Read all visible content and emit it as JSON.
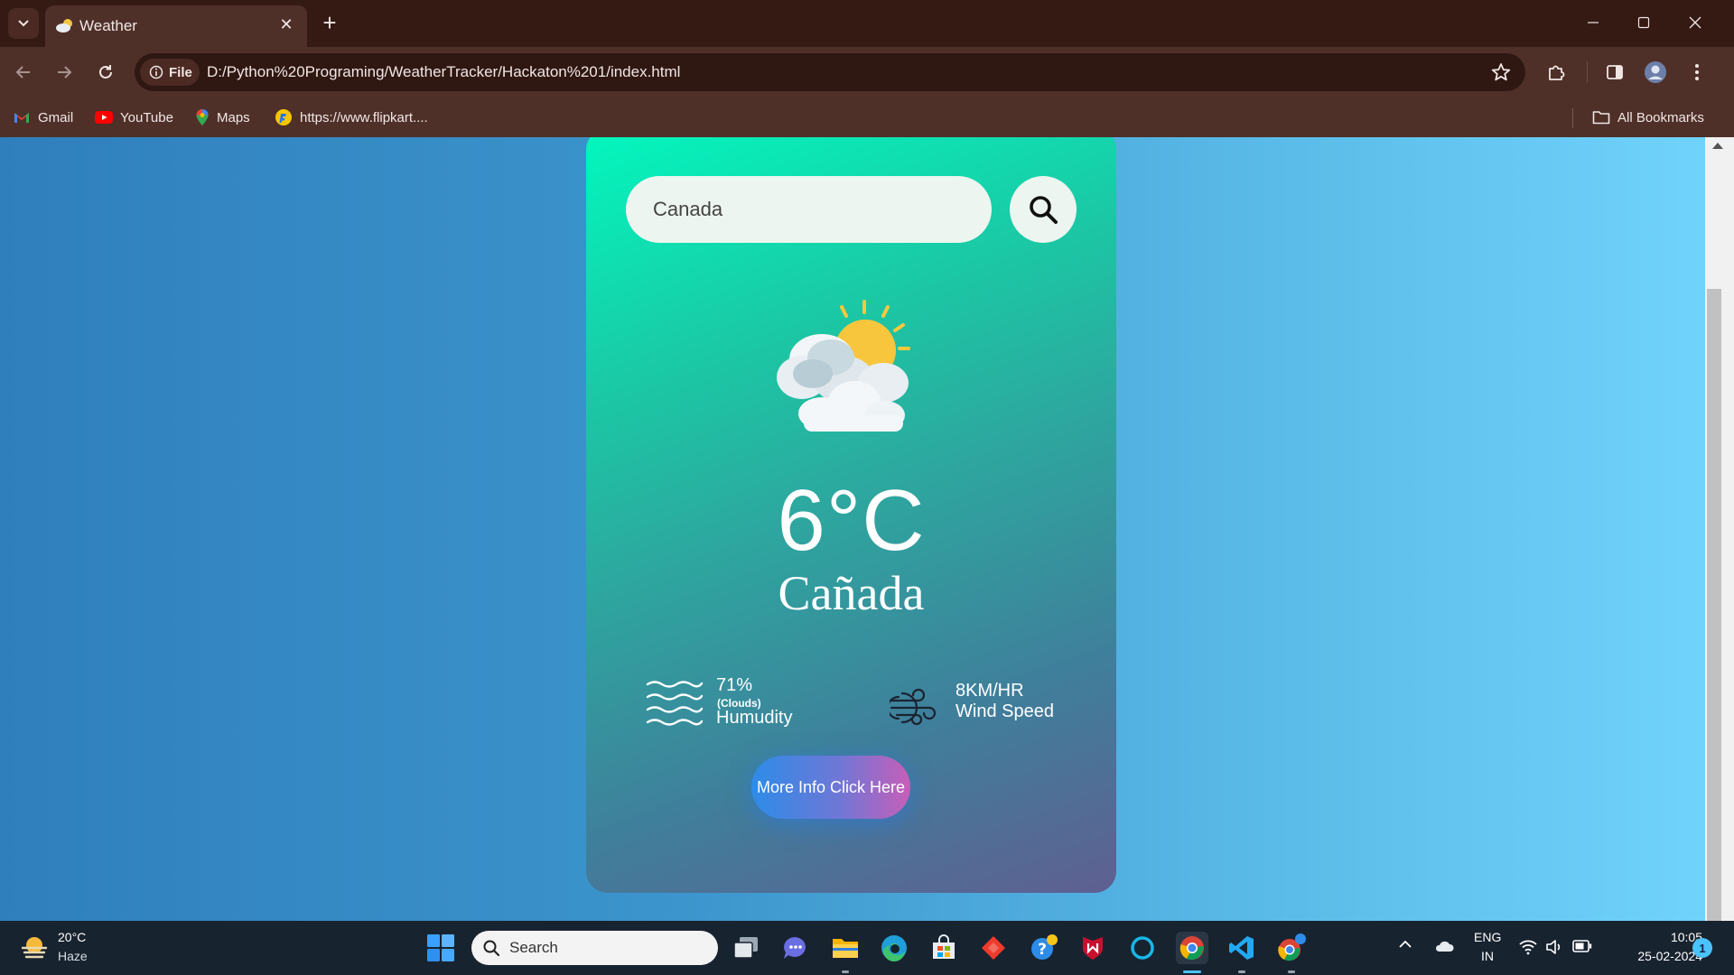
{
  "browser": {
    "tab_title": "Weather",
    "new_tab_symbol": "+",
    "close_symbol": "✕",
    "site_info_label": "File",
    "url": "D:/Python%20Programing/WeatherTracker/Hackaton%201/index.html",
    "bookmarks": [
      {
        "label": "Gmail",
        "icon": "gmail-icon"
      },
      {
        "label": "YouTube",
        "icon": "youtube-icon"
      },
      {
        "label": "Maps",
        "icon": "maps-icon"
      },
      {
        "label": "https://www.flipkart....",
        "icon": "flipkart-icon"
      }
    ],
    "all_bookmarks_label": "All Bookmarks"
  },
  "weather_app": {
    "search": {
      "value": "Canada"
    },
    "condition_icon": "sun-behind-clouds-icon",
    "temperature": "6°C",
    "city": "Cañada",
    "humidity": {
      "value": "71%",
      "note": "(Clouds)",
      "label": "Humudity"
    },
    "wind": {
      "value": "8KM/HR",
      "label": "Wind Speed"
    },
    "more_info_label": "More Info Click Here",
    "colors": {
      "card_gradient_start": "#03f7be",
      "card_gradient_end": "#5f5f91",
      "page_bg_left": "#2f7fbd",
      "page_bg_right": "#70d3fb",
      "button_gradient_start": "#2d8ce8",
      "button_gradient_end": "#c65fb8"
    }
  },
  "taskbar": {
    "weather_temp": "20°C",
    "weather_desc": "Haze",
    "search_placeholder": "Search",
    "lang_line1": "ENG",
    "lang_line2": "IN",
    "time": "10:05",
    "date": "25-02-2024",
    "notification_count": "1"
  }
}
